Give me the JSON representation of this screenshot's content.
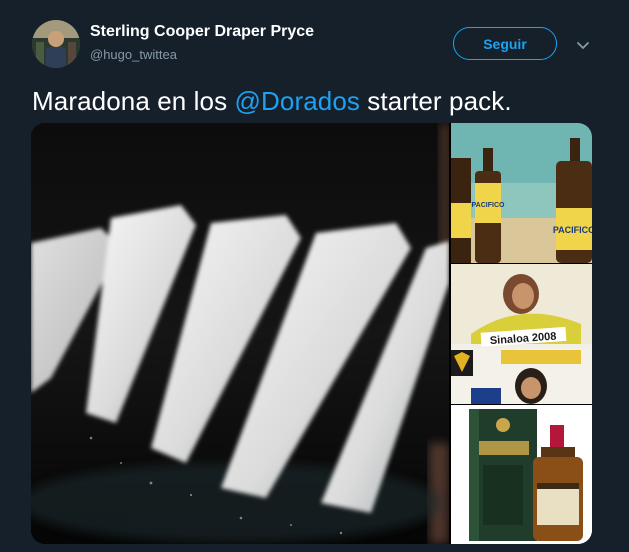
{
  "author": {
    "display_name": "Sterling Cooper Draper Pryce",
    "handle": "@hugo_twittea"
  },
  "actions": {
    "follow_label": "Seguir",
    "more_icon": "chevron-down-icon"
  },
  "tweet": {
    "text_before": "Maradona en los ",
    "mention": "@Dorados",
    "text_after": " starter pack."
  },
  "media": {
    "side_2_caption": "Sinaloa 2008"
  },
  "colors": {
    "background": "#15202b",
    "accent": "#1da1f2",
    "secondary_text": "#8899a6"
  }
}
